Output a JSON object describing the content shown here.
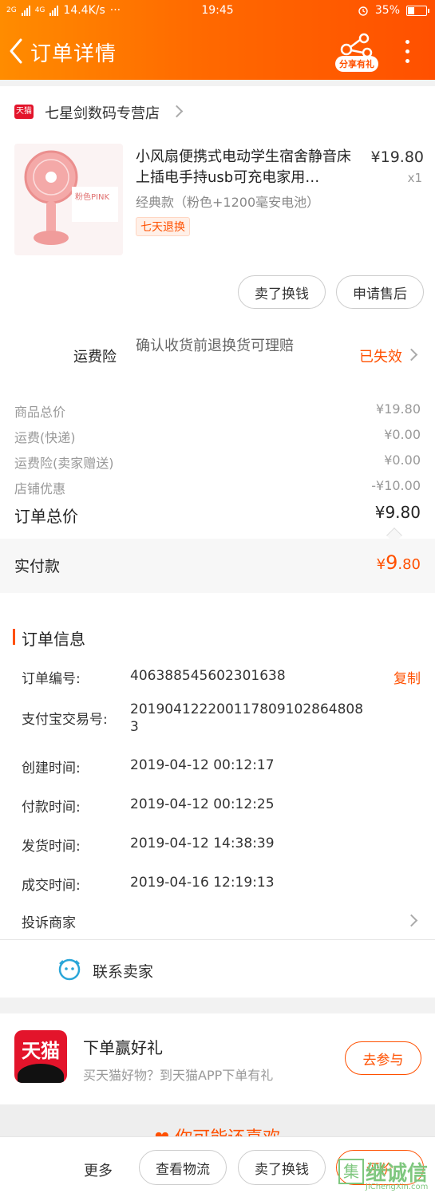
{
  "status_bar": {
    "network": "2G",
    "network2": "4G",
    "speed": "14.4K/s",
    "dots": "···",
    "time": "19:45",
    "battery": "35%"
  },
  "header": {
    "title": "订单详情",
    "share_label": "分享有礼"
  },
  "shop": {
    "name": "七星剑数码专营店",
    "badge": "天猫"
  },
  "product": {
    "title": "小风扇便携式电动学生宿舍静音床上插电手持usb可充电家用…",
    "price": "¥19.80",
    "qty": "x1",
    "sku": "经典款（粉色+1200毫安电池）",
    "tag": "七天退换",
    "image_label": "粉色PINK"
  },
  "actions": {
    "sell": "卖了换钱",
    "after_sale": "申请售后"
  },
  "insurance": {
    "label": "运费险",
    "desc": "确认收货前退换货可理赔",
    "status": "已失效"
  },
  "fees": [
    {
      "label": "商品总价",
      "value": "¥19.80"
    },
    {
      "label": "运费(快递)",
      "value": "¥0.00"
    },
    {
      "label": "运费险(卖家赠送)",
      "value": "¥0.00"
    },
    {
      "label": "店铺优惠",
      "value": "-¥10.00"
    }
  ],
  "total": {
    "label": "订单总价",
    "value": "¥9.80"
  },
  "paid": {
    "label": "实付款",
    "currency": "¥",
    "int": "9",
    "dec": ".80"
  },
  "order_info": {
    "title": "订单信息",
    "copy": "复制",
    "rows": [
      {
        "label": "订单编号:",
        "value": "406388545602301638"
      },
      {
        "label": "支付宝交易号:",
        "value": "2019041222001178091028648083"
      },
      {
        "label": "创建时间:",
        "value": "2019-04-12 00:12:17"
      },
      {
        "label": "付款时间:",
        "value": "2019-04-12 00:12:25"
      },
      {
        "label": "发货时间:",
        "value": "2019-04-12 14:38:39"
      },
      {
        "label": "成交时间:",
        "value": "2019-04-16 12:19:13"
      }
    ],
    "complain": "投诉商家",
    "contact": "联系卖家"
  },
  "promo": {
    "logo": "天猫",
    "title": "下单赢好礼",
    "subtitle": "买天猫好物？到天猫APP下单有礼",
    "button": "去参与"
  },
  "guess": "你可能还喜欢",
  "bottom_bar": {
    "more": "更多",
    "logistics": "查看物流",
    "sell": "卖了换钱",
    "review": "评价"
  },
  "watermark": {
    "main": "继诚信",
    "sub": "JiChengXin.com",
    "box": "集"
  },
  "colors": {
    "accent": "#ff5000",
    "header_start": "#ff8c00",
    "tmall_red": "#e3142b"
  }
}
